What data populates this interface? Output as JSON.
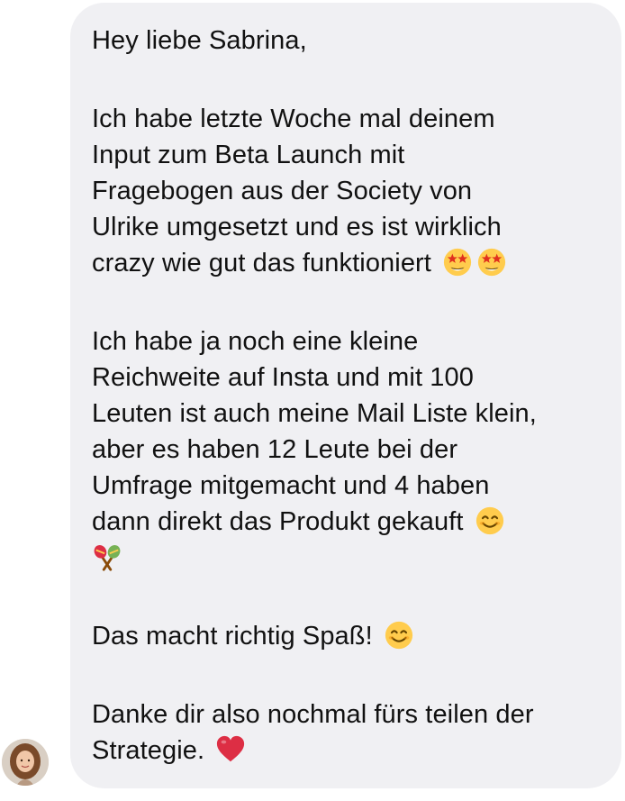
{
  "message": {
    "greeting": "Hey liebe Sabrina,",
    "p1": [
      "Ich habe letzte Woche mal deinem",
      "Input zum Beta Launch mit",
      "Fragebogen aus der Society von",
      "Ulrike umgesetzt und es ist wirklich",
      "crazy wie gut das funktioniert"
    ],
    "p2": [
      "Ich habe ja noch eine kleine",
      "Reichweite auf Insta und mit 100",
      "Leuten ist auch meine Mail Liste klein,",
      "aber es haben 12 Leute bei der",
      "Umfrage mitgemacht und 4 haben",
      "dann direkt das Produkt gekauft"
    ],
    "p3": "Das macht richtig Spaß!",
    "p4": [
      "Danke dir also nochmal fürs teilen der",
      "Strategie."
    ]
  },
  "icons": {
    "star_struck": "star-struck-emoji-icon",
    "smile": "smiling-face-emoji-icon",
    "maracas": "maracas-emoji-icon",
    "heart": "red-heart-emoji-icon",
    "avatar": "sender-avatar"
  },
  "colors": {
    "bubble": "#f0f0f3",
    "text": "#111111"
  }
}
